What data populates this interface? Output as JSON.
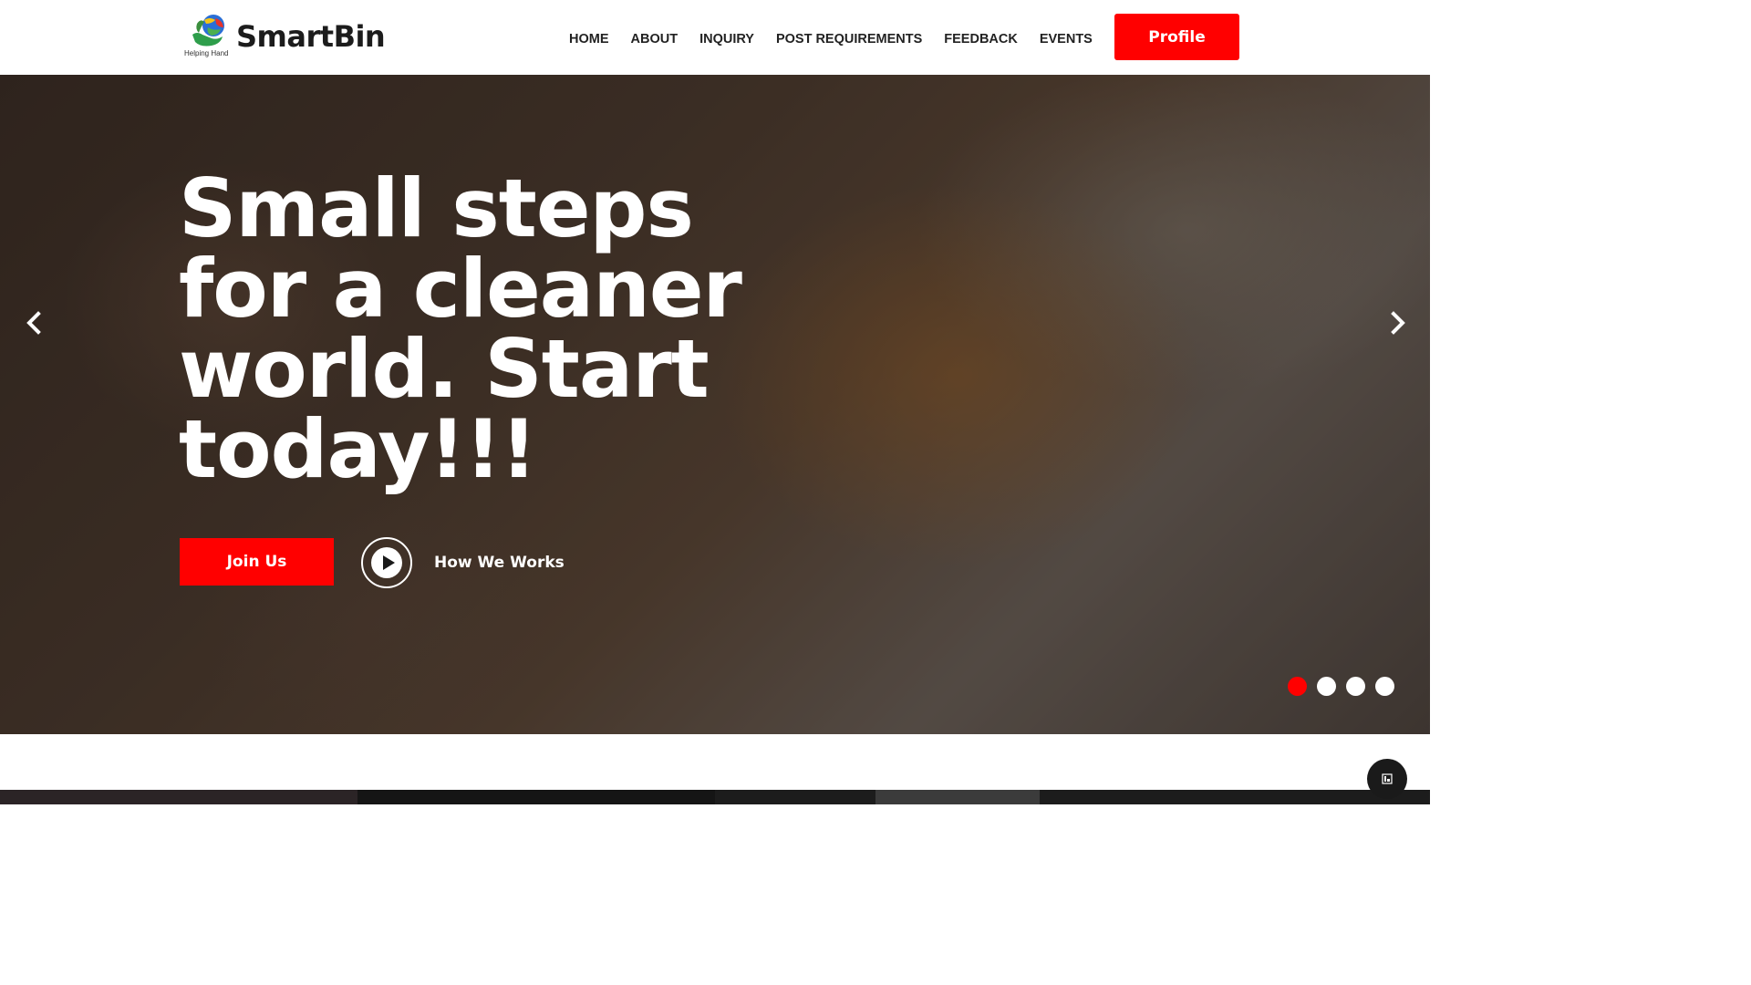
{
  "header": {
    "logo_name": "SmartBin",
    "logo_tagline": "Helping Hand",
    "nav": [
      {
        "label": "HOME"
      },
      {
        "label": "ABOUT"
      },
      {
        "label": "INQUIRY"
      },
      {
        "label": "POST REQUIREMENTS"
      },
      {
        "label": "FEEDBACK"
      },
      {
        "label": "EVENTS"
      }
    ],
    "profile_label": "Profile"
  },
  "hero": {
    "title": "Small steps for a cleaner world. Start today!!!",
    "join_label": "Join Us",
    "how_label": "How We Works",
    "slides_count": 4,
    "active_slide": 1
  },
  "colors": {
    "accent": "#ff0000",
    "text_dark": "#222222",
    "hero_text": "#ffffff"
  },
  "icons": {
    "logo": "globe-hand-logo-icon",
    "prev": "chevron-left-icon",
    "next": "chevron-right-icon",
    "play": "play-icon",
    "scroll_top": "scroll-top-icon"
  }
}
